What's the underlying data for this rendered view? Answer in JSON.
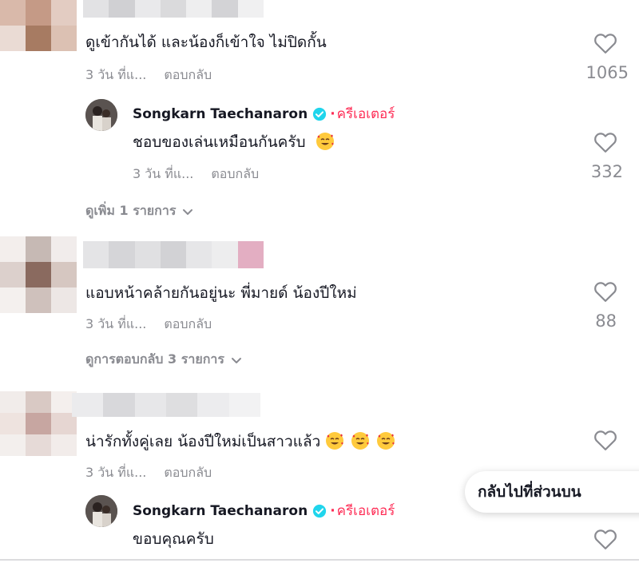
{
  "comments": [
    {
      "text": "ดูเข้ากันได้ และน้องก็เข้าใจ ไม่ปิดกั้น",
      "time": "3 วัน ที่แ...",
      "reply_label": "ตอบกลับ",
      "likes": "1065",
      "reply": {
        "author": "Songkarn Taechanaron",
        "creator_label": "ครีเอเตอร์",
        "text": "ชอบของเล่นเหมือนกันครับ",
        "time": "3 วัน ที่แ...",
        "reply_label": "ตอบกลับ",
        "likes": "332"
      },
      "view_more": "ดูเพิ่ม 1 รายการ"
    },
    {
      "text": "แอบหน้าคล้ายกันอยู่นะ พี่มายด์ น้องปีใหม่",
      "time": "3 วัน ที่แ...",
      "reply_label": "ตอบกลับ",
      "likes": "88",
      "view_more": "ดูการตอบกลับ 3 รายการ"
    },
    {
      "text": "น่ารักทั้งคู่เลย น้องปีใหม่เป็นสาวแล้ว",
      "time": "3 วัน ที่แ...",
      "reply_label": "ตอบกลับ",
      "likes": "",
      "reply": {
        "author": "Songkarn Taechanaron",
        "creator_label": "ครีเอเตอร์",
        "text": "ขอบคุณครับ",
        "likes": ""
      }
    }
  ],
  "back_to_top": "กลับไปที่ส่วนบน",
  "icons": {
    "heart": "heart-outline-icon",
    "verified": "verified-badge-icon",
    "chevron": "chevron-down-icon",
    "emoji": "smiling-face-with-hearts"
  },
  "colors": {
    "text": "#161823",
    "muted": "#8a8b91",
    "creator": "#fe2c55",
    "verified": "#20d5ec"
  }
}
